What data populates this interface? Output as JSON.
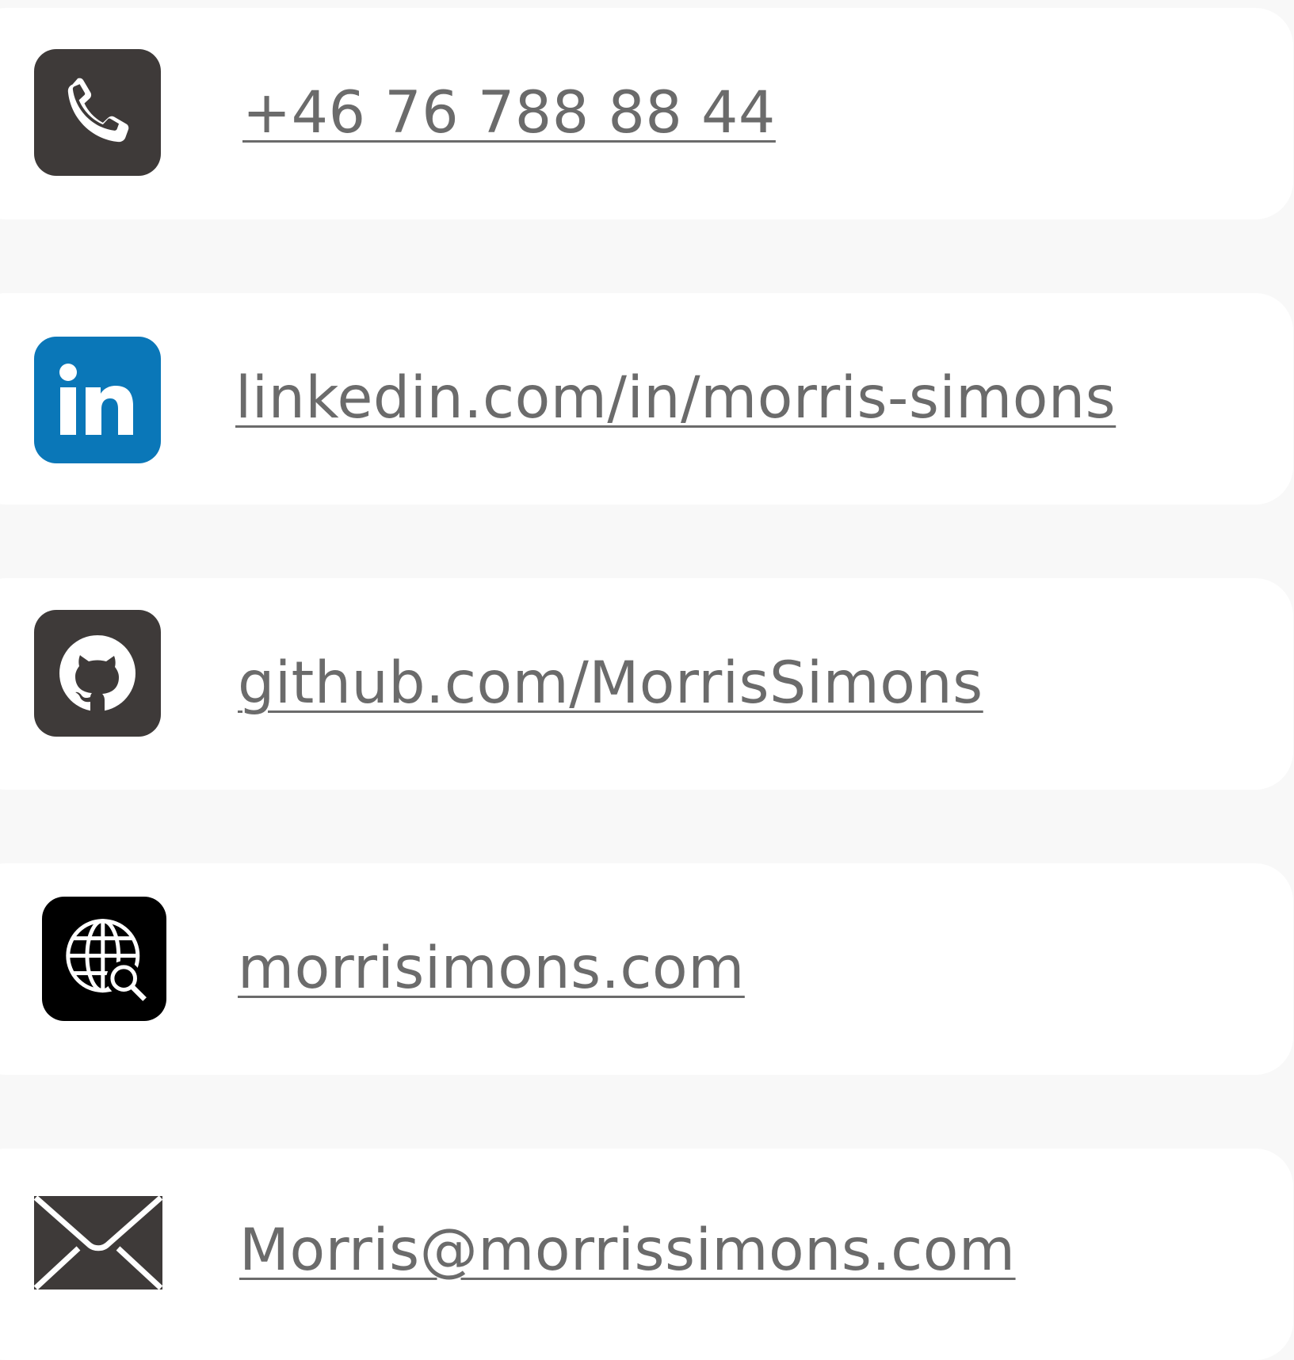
{
  "contacts": [
    {
      "icon": "phone-icon",
      "text": "+46 76 788 88 44"
    },
    {
      "icon": "linkedin-icon",
      "text": "linkedin.com/in/morris-simons"
    },
    {
      "icon": "github-icon",
      "text": "github.com/MorrisSimons"
    },
    {
      "icon": "web-search-icon",
      "text": "morrisimons.com"
    },
    {
      "icon": "mail-icon",
      "text": "Morris@morrissimons.com"
    }
  ],
  "colors": {
    "page_background": "#f8f8f8",
    "card_background": "#ffffff",
    "link_text": "#6b6b6b",
    "icon_dark": "#3e3a39",
    "icon_black": "#000000",
    "linkedin_blue": "#0a77b8"
  }
}
